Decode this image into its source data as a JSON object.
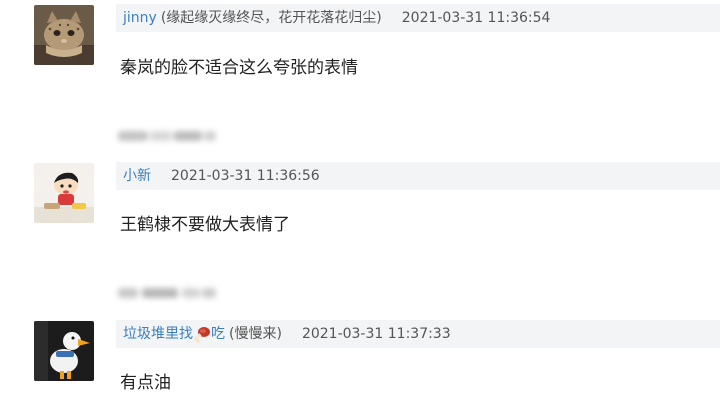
{
  "comments": [
    {
      "username": "jinny",
      "note": "(缘起缘灭缘终尽，花开花落花归尘)",
      "timestamp": "2021-03-31 11:36:54",
      "content": "秦岚的脸不适合这么夸张的表情",
      "avatar_icon": "cat-avatar-icon"
    },
    {
      "username": "小新",
      "note": "",
      "timestamp": "2021-03-31 11:36:56",
      "content": "王鹤棣不要做大表情了",
      "avatar_icon": "cartoon-boy-avatar-icon"
    },
    {
      "username_prefix": "垃圾堆里找",
      "username_suffix": "吃",
      "note": "(慢慢来)",
      "timestamp": "2021-03-31 11:37:33",
      "content": "有点油",
      "avatar_icon": "duck-toy-avatar-icon",
      "emoji_icon": "drumstick-icon"
    }
  ],
  "colors": {
    "username": "#3c7fc0",
    "meta_background": "#f2f4f5",
    "meta_text": "#555555",
    "content_text": "#222222"
  }
}
